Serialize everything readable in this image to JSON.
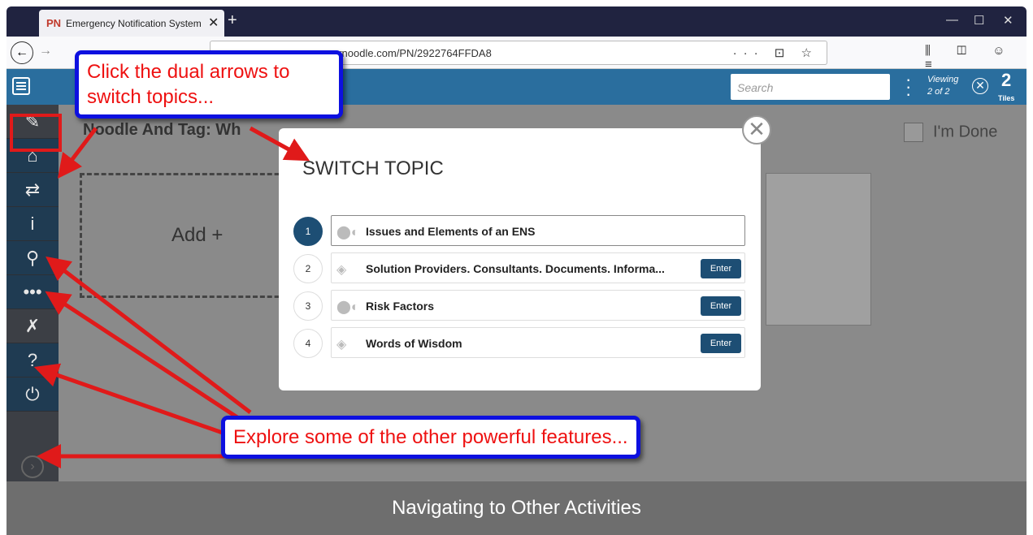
{
  "browser": {
    "tab_logo": "PN",
    "tab_title": "Emergency Notification System",
    "url": "ernoodle.com/PN/2922764FFDA8",
    "new_tab": "+",
    "tab_close": "✕",
    "page_actions": "··· ⊡ ☆"
  },
  "app": {
    "search_placeholder": "Search",
    "viewing_label": "Viewing",
    "viewing_value": "2 of 2",
    "tiles_count": "2",
    "tiles_label": "Tiles",
    "content_title": "Noodle And Tag: Wh",
    "add_label": "Add +",
    "done_label": "I'm Done"
  },
  "sidebar": {
    "icons": [
      "pencil-icon",
      "home-icon",
      "switch-topic-icon",
      "info-icon",
      "search-icon",
      "dots-icon",
      "wrench-icon",
      "help-icon",
      "power-icon"
    ]
  },
  "modal": {
    "title": "SWITCH TOPIC",
    "topics": [
      {
        "num": "1",
        "label": "Issues and Elements of an ENS",
        "enter": "",
        "icon": "toggle-icon",
        "active": true
      },
      {
        "num": "2",
        "label": "Solution Providers. Consultants. Documents. Informa...",
        "enter": "Enter",
        "icon": "tag-icon",
        "active": false
      },
      {
        "num": "3",
        "label": "Risk Factors",
        "enter": "Enter",
        "icon": "toggle-icon",
        "active": false
      },
      {
        "num": "4",
        "label": "Words of Wisdom",
        "enter": "Enter",
        "icon": "tag-icon",
        "active": false
      }
    ]
  },
  "callouts": {
    "top": "Click the dual arrows to switch topics...",
    "bottom": "Explore some of the other powerful features..."
  },
  "footer": {
    "caption": "Navigating to Other Activities"
  },
  "colors": {
    "accent": "#1d4e74",
    "header": "#2a6e9e",
    "callout_border": "#0d10e0",
    "callout_text": "#ee1111",
    "arrow": "#e01a1a"
  }
}
